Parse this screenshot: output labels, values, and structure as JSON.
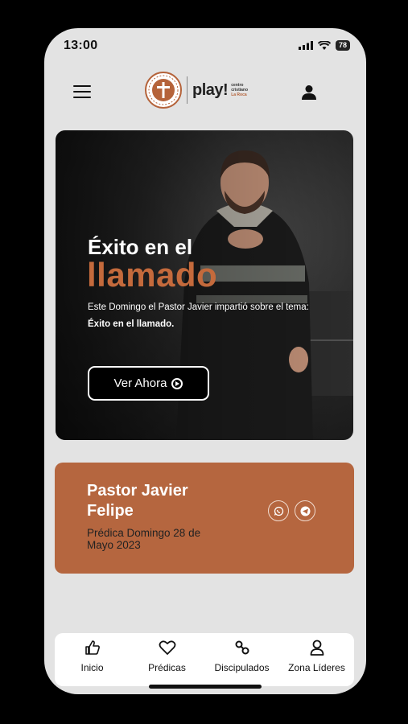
{
  "status_bar": {
    "time": "13:00",
    "battery": "78"
  },
  "header": {
    "play_word": "play!",
    "play_sub_line1": "centro",
    "play_sub_line2": "cristiano",
    "play_sub_line3": "La Roca"
  },
  "hero": {
    "title_line1": "Éxito en el",
    "title_line2": "llamado",
    "description_prefix": "Este Domingo el Pastor Javier impartió sobre el tema: ",
    "description_bold": "Éxito en el llamado.",
    "cta_label": "Ver Ahora"
  },
  "sermon_card": {
    "pastor_name": "Pastor Javier Felipe",
    "date_text": "Prédica Domingo 28 de Mayo 2023"
  },
  "tab_bar": {
    "items": [
      {
        "label": "Inicio",
        "icon": "thumbs-up-icon"
      },
      {
        "label": "Prédicas",
        "icon": "heart-icon"
      },
      {
        "label": "Discipulados",
        "icon": "link-icon"
      },
      {
        "label": "Zona Líderes",
        "icon": "person-icon"
      }
    ]
  },
  "colors": {
    "accent": "#c46a3c",
    "card": "#b5663f",
    "background": "#e3e3e3"
  }
}
